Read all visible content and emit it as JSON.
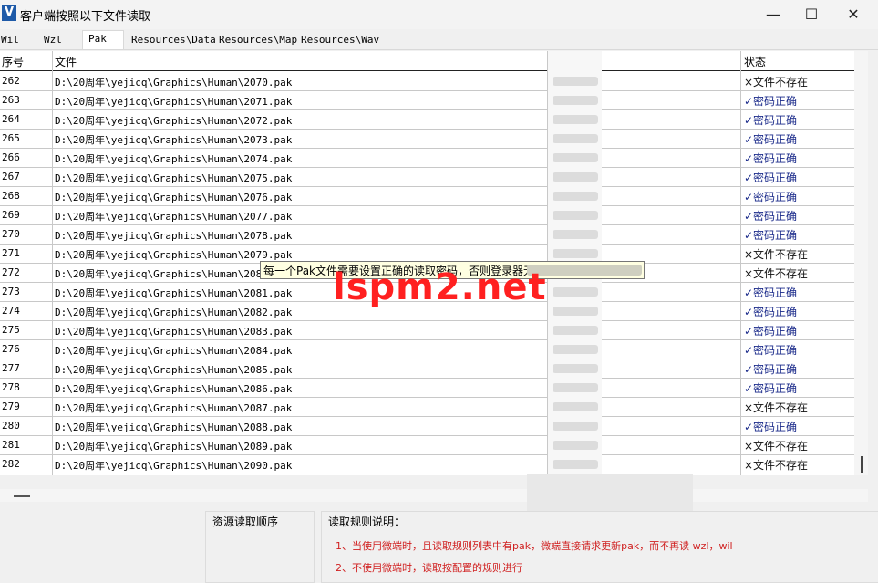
{
  "window": {
    "title": "客户端按照以下文件读取",
    "icon_letter": "V",
    "controls": {
      "minimize": "—",
      "maximize": "☐",
      "close": "✕"
    }
  },
  "tabs": [
    "Wil",
    "Wzl",
    "Pak",
    "Resources\\Data",
    "Resources\\Map",
    "Resources\\Wav"
  ],
  "active_tab": "Pak",
  "grid": {
    "headers": {
      "index": "序号",
      "file": "文件",
      "status": "状态"
    },
    "rows": [
      {
        "index": "262",
        "file": "D:\\20周年\\yejicq\\Graphics\\Human\\2070.pak",
        "status": "×文件不存在"
      },
      {
        "index": "263",
        "file": "D:\\20周年\\yejicq\\Graphics\\Human\\2071.pak",
        "status": "✓密码正确"
      },
      {
        "index": "264",
        "file": "D:\\20周年\\yejicq\\Graphics\\Human\\2072.pak",
        "status": "✓密码正确"
      },
      {
        "index": "265",
        "file": "D:\\20周年\\yejicq\\Graphics\\Human\\2073.pak",
        "status": "✓密码正确"
      },
      {
        "index": "266",
        "file": "D:\\20周年\\yejicq\\Graphics\\Human\\2074.pak",
        "status": "✓密码正确"
      },
      {
        "index": "267",
        "file": "D:\\20周年\\yejicq\\Graphics\\Human\\2075.pak",
        "status": "✓密码正确"
      },
      {
        "index": "268",
        "file": "D:\\20周年\\yejicq\\Graphics\\Human\\2076.pak",
        "status": "✓密码正确"
      },
      {
        "index": "269",
        "file": "D:\\20周年\\yejicq\\Graphics\\Human\\2077.pak",
        "status": "✓密码正确"
      },
      {
        "index": "270",
        "file": "D:\\20周年\\yejicq\\Graphics\\Human\\2078.pak",
        "status": "✓密码正确"
      },
      {
        "index": "271",
        "file": "D:\\20周年\\yejicq\\Graphics\\Human\\2079.pak",
        "status": "×文件不存在"
      },
      {
        "index": "272",
        "file": "D:\\20周年\\yejicq\\Graphics\\Human\\2080.pak",
        "status": "×文件不存在"
      },
      {
        "index": "273",
        "file": "D:\\20周年\\yejicq\\Graphics\\Human\\2081.pak",
        "status": "✓密码正确"
      },
      {
        "index": "274",
        "file": "D:\\20周年\\yejicq\\Graphics\\Human\\2082.pak",
        "status": "✓密码正确"
      },
      {
        "index": "275",
        "file": "D:\\20周年\\yejicq\\Graphics\\Human\\2083.pak",
        "status": "✓密码正确"
      },
      {
        "index": "276",
        "file": "D:\\20周年\\yejicq\\Graphics\\Human\\2084.pak",
        "status": "✓密码正确"
      },
      {
        "index": "277",
        "file": "D:\\20周年\\yejicq\\Graphics\\Human\\2085.pak",
        "status": "✓密码正确"
      },
      {
        "index": "278",
        "file": "D:\\20周年\\yejicq\\Graphics\\Human\\2086.pak",
        "status": "✓密码正确"
      },
      {
        "index": "279",
        "file": "D:\\20周年\\yejicq\\Graphics\\Human\\2087.pak",
        "status": "×文件不存在"
      },
      {
        "index": "280",
        "file": "D:\\20周年\\yejicq\\Graphics\\Human\\2088.pak",
        "status": "✓密码正确"
      },
      {
        "index": "281",
        "file": "D:\\20周年\\yejicq\\Graphics\\Human\\2089.pak",
        "status": "×文件不存在"
      },
      {
        "index": "282",
        "file": "D:\\20周年\\yejicq\\Graphics\\Human\\2090.pak",
        "status": "×文件不存在"
      }
    ]
  },
  "tooltip": {
    "text": "每一个Pak文件需要设置正确的读取密码，否则登录器无"
  },
  "watermark": "lspm2.net",
  "bottom": {
    "left_title": "资源读取顺序",
    "right_title": "读取规则说明：",
    "rules": [
      "1、当使用微端时，且读取规则列表中有pak，微端直接请求更新pak，而不再读 wzl，wil",
      "2、不使用微端时，读取按配置的规则进行"
    ]
  },
  "colors": {
    "ok_status": "#1a2a8a",
    "rule_text": "#d02020",
    "tooltip_bg": "#ffffe1",
    "watermark": "#ff2020",
    "icon_bg": "#1e5aa8"
  }
}
